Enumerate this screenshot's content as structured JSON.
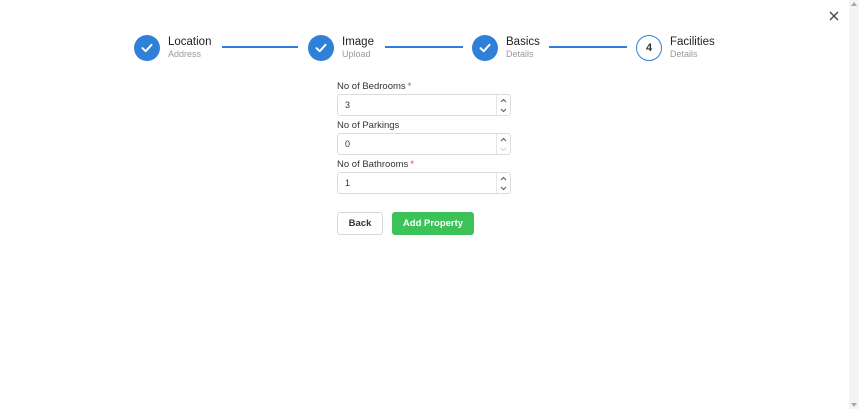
{
  "stepper": {
    "steps": [
      {
        "title": "Location",
        "subtitle": "Address",
        "state": "completed",
        "icon": "check-icon"
      },
      {
        "title": "Image",
        "subtitle": "Upload",
        "state": "completed",
        "icon": "check-icon"
      },
      {
        "title": "Basics",
        "subtitle": "Details",
        "state": "completed",
        "icon": "check-icon"
      },
      {
        "title": "Facilities",
        "subtitle": "Details",
        "state": "active",
        "number": "4"
      }
    ]
  },
  "form": {
    "fields": [
      {
        "label": "No of Bedrooms",
        "required_mark": "*",
        "value": "3"
      },
      {
        "label": "No of Parkings",
        "required_mark": "",
        "value": "0"
      },
      {
        "label": "No of Bathrooms",
        "required_mark": "*",
        "value": "1"
      }
    ]
  },
  "actions": {
    "back_label": "Back",
    "submit_label": "Add Property"
  },
  "colors": {
    "primary": "#2f80d8",
    "success": "#3cc259",
    "required": "#e53935"
  }
}
